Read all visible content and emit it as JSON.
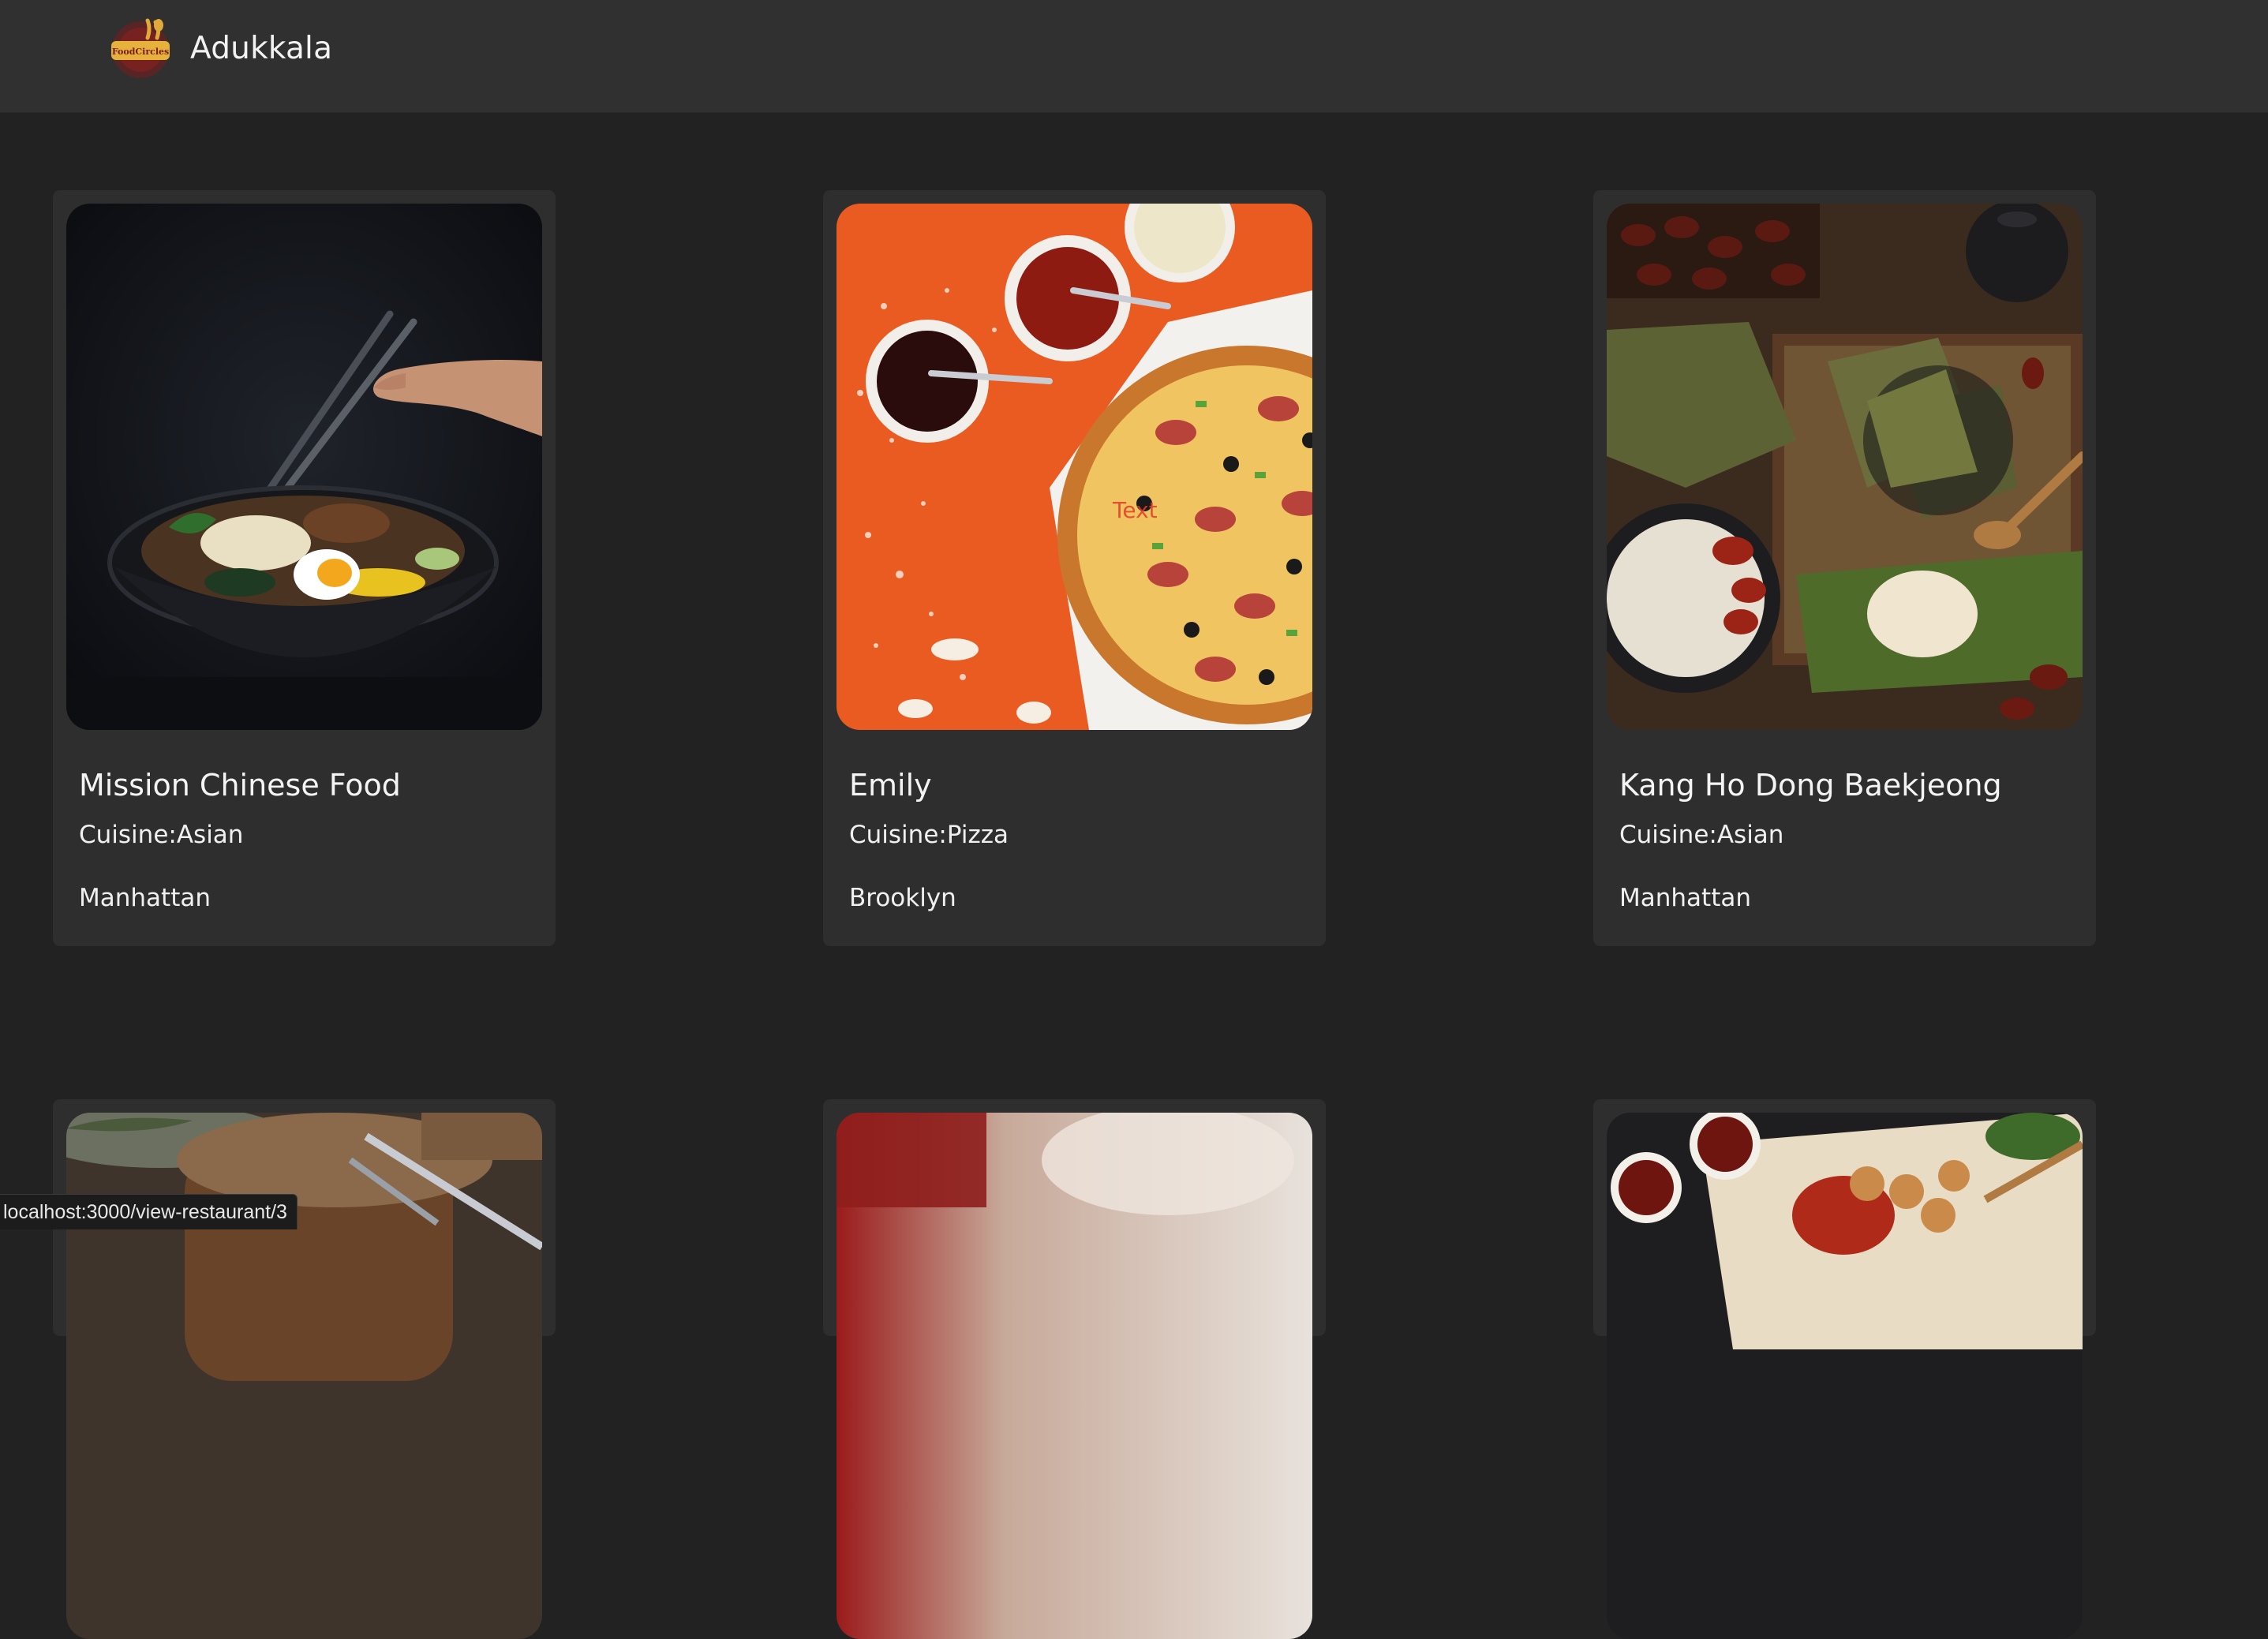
{
  "app": {
    "brand_name": "Adukkala",
    "logo_text": "FoodCircles"
  },
  "restaurants": [
    {
      "name": "Mission Chinese Food",
      "cuisine": "Cuisine:Asian",
      "location": "Manhattan",
      "image": "noodle-bowl-image"
    },
    {
      "name": "Emily",
      "cuisine": "Cuisine:Pizza",
      "location": "Brooklyn",
      "image": "pizza-image",
      "image_overlay_text": "Text"
    },
    {
      "name": "Kang Ho Dong Baekjeong",
      "cuisine": "Cuisine:Asian",
      "location": "Manhattan",
      "image": "dumplings-image"
    },
    {
      "image": "steak-plate-image"
    },
    {
      "image": "blurred-restaurant-image"
    },
    {
      "image": "grilled-platter-image"
    }
  ],
  "status_bar": {
    "url": "localhost:3000/view-restaurant/3"
  },
  "colors": {
    "page_bg": "#222222",
    "navbar_bg": "#303030",
    "card_bg": "#2e2e2e",
    "text": "#f4f4f4"
  }
}
